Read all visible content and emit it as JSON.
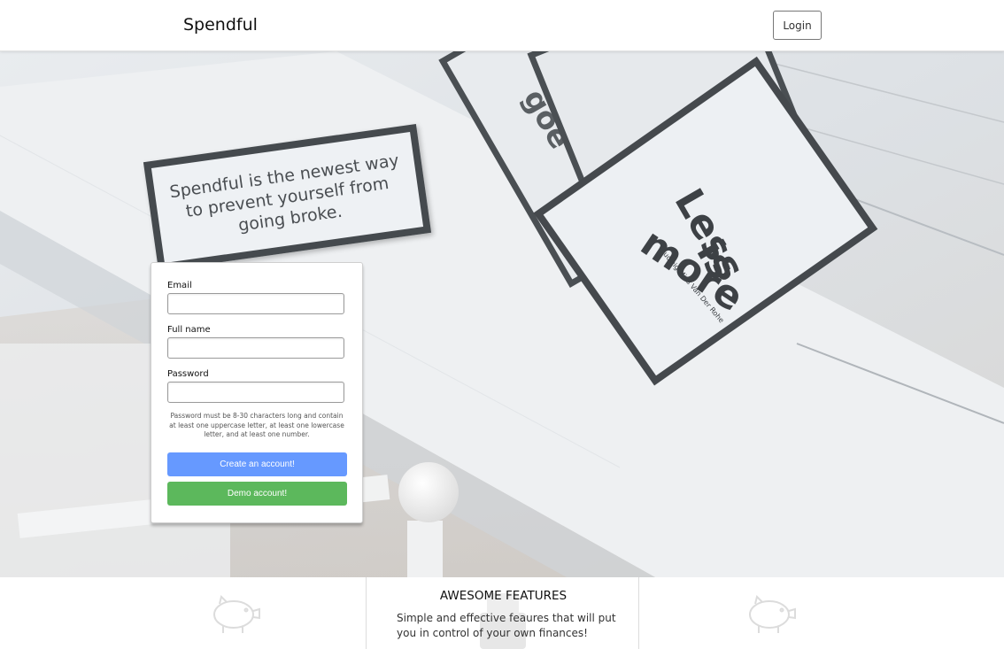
{
  "header": {
    "brand": "Spendful",
    "login_label": "Login"
  },
  "hero": {
    "tagline": "Spendful is the newest way to prevent yourself from going broke.",
    "background_cards": {
      "main_card_text": [
        "Less",
        "is",
        "more"
      ],
      "main_card_author": "Ludwig Mies Van Der Rohe",
      "partial_card_text": "goe"
    }
  },
  "signup": {
    "email_label": "Email",
    "email_value": "",
    "fullname_label": "Full name",
    "fullname_value": "",
    "password_label": "Password",
    "password_value": "",
    "password_hint": "Password must be 8-30 characters long and contain at least one uppercase letter, at least one lowercase letter, and at least one number.",
    "create_label": "Create an account!",
    "demo_label": "Demo account!"
  },
  "features": {
    "title": "AWESOME FEATURES",
    "description": "Simple and effective feaures that will put you in control of your own finances!",
    "left_icon": "piggy-bank-icon",
    "right_icon": "piggy-bank-icon",
    "center_icon": "wallet-icon"
  },
  "colors": {
    "primary_button": "#6699ff",
    "demo_button": "#5cb85c",
    "card_border": "#454a4e"
  }
}
